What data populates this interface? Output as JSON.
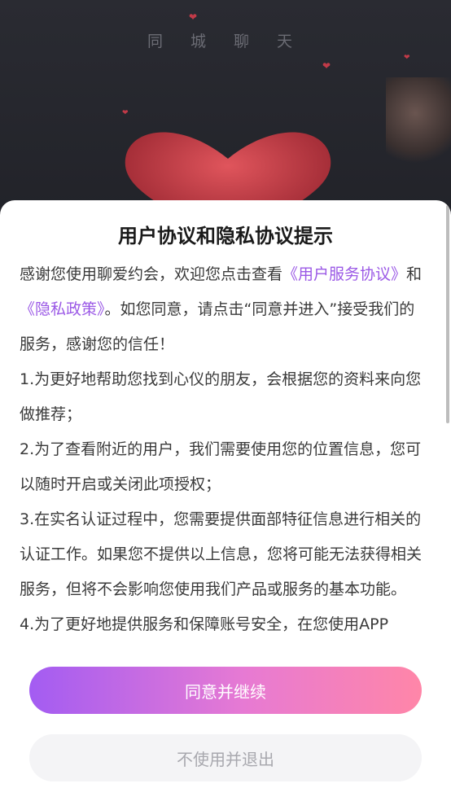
{
  "background": {
    "app_title": "同 城 聊 天"
  },
  "dialog": {
    "title": "用户协议和隐私协议提示",
    "intro_prefix": "感谢您使用聊爱约会，欢迎您点击查看",
    "user_agreement_link": "《用户服务协议》",
    "and_text": "和",
    "privacy_policy_link": "《隐私政策》",
    "intro_suffix": "。如您同意，请点击“同意并进入”接受我们的服务，感谢您的信任！",
    "items": [
      "1.为更好地帮助您找到心仪的朋友，会根据您的资料来向您做推荐；",
      "2.为了查看附近的用户，我们需要使用您的位置信息，您可以随时开启或关闭此项授权；",
      "3.在实名认证过程中，您需要提供面部特征信息进行相关的认证工作。如果您不提供以上信息，您将可能无法获得相关服务，但将不会影响您使用我们产品或服务的基本功能。",
      "4.为了更好地提供服务和保障账号安全，在您使用APP"
    ],
    "agree_button": "同意并继续",
    "decline_button": "不使用并退出"
  },
  "colors": {
    "link": "#9b59e6",
    "primary_gradient_start": "#a35cf2",
    "primary_gradient_end": "#ff86a8",
    "secondary_bg": "#f4f4f6"
  }
}
